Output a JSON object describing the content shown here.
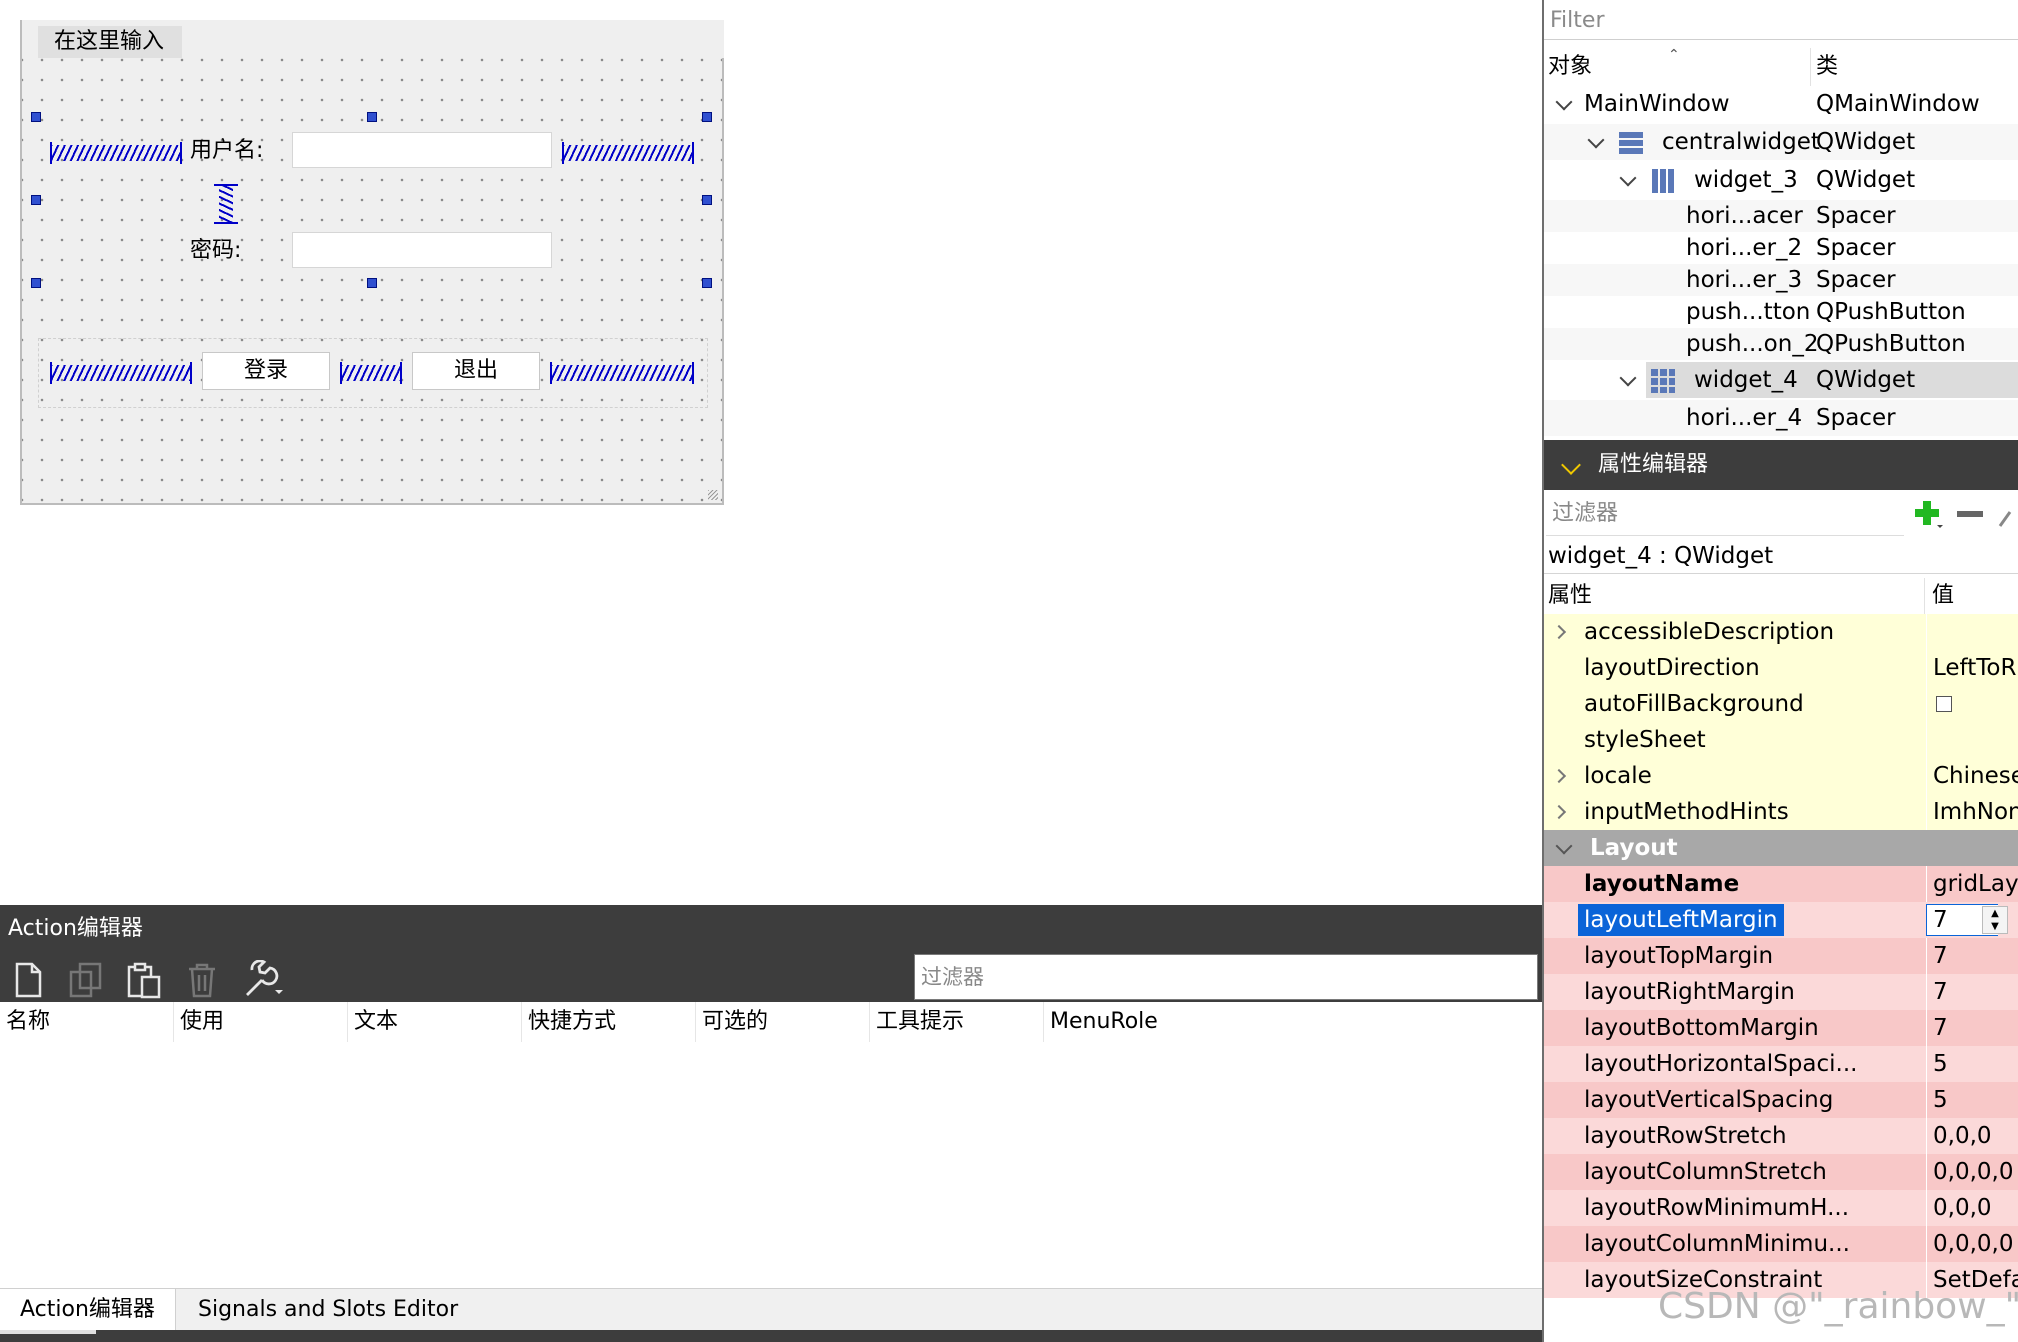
{
  "form": {
    "menu_title": "在这里输入",
    "username_label": "用户名:",
    "password_label": "密码:",
    "login_button": "登录",
    "exit_button": "退出"
  },
  "action_editor": {
    "title": "Action编辑器",
    "filter_placeholder": "过滤器",
    "columns": [
      "名称",
      "使用",
      "文本",
      "快捷方式",
      "可选的",
      "工具提示",
      "MenuRole"
    ],
    "toolbar_icons": [
      "new-action-icon",
      "copy-action-icon",
      "paste-action-icon",
      "delete-action-icon",
      "configure-wrench-icon"
    ]
  },
  "bottom_tabs": [
    "Action编辑器",
    "Signals and Slots Editor"
  ],
  "object_inspector": {
    "filter_placeholder": "Filter",
    "headers": {
      "object": "对象",
      "class": "类"
    },
    "rows": [
      {
        "name": "MainWindow",
        "class": "QMainWindow",
        "icon": ""
      },
      {
        "name": "centralwidget",
        "class": "QWidget",
        "icon": "vertical-layout-icon"
      },
      {
        "name": "widget_3",
        "class": "QWidget",
        "icon": "horizontal-layout-icon"
      },
      {
        "name": "hori...acer",
        "class": "Spacer",
        "icon": ""
      },
      {
        "name": "hori...er_2",
        "class": "Spacer",
        "icon": ""
      },
      {
        "name": "hori...er_3",
        "class": "Spacer",
        "icon": ""
      },
      {
        "name": "push...tton",
        "class": "QPushButton",
        "icon": ""
      },
      {
        "name": "push...on_2",
        "class": "QPushButton",
        "icon": ""
      },
      {
        "name": "widget_4",
        "class": "QWidget",
        "icon": "grid-layout-icon"
      },
      {
        "name": "hori...er_4",
        "class": "Spacer",
        "icon": ""
      }
    ]
  },
  "property_editor": {
    "title": "属性编辑器",
    "filter_placeholder": "过滤器",
    "object_label": "widget_4 : QWidget",
    "headers": {
      "property": "属性",
      "value": "值"
    },
    "widget_props": [
      {
        "name": "accessibleDescription",
        "value": ""
      },
      {
        "name": "layoutDirection",
        "value": "LeftToRight"
      },
      {
        "name": "autoFillBackground",
        "value": ""
      },
      {
        "name": "styleSheet",
        "value": ""
      },
      {
        "name": "locale",
        "value": "Chinese, China"
      },
      {
        "name": "inputMethodHints",
        "value": "ImhNone"
      }
    ],
    "layout_section": "Layout",
    "layout_props": [
      {
        "name": "layoutName",
        "value": "gridLayout"
      },
      {
        "name": "layoutLeftMargin",
        "value": "7"
      },
      {
        "name": "layoutTopMargin",
        "value": "7"
      },
      {
        "name": "layoutRightMargin",
        "value": "7"
      },
      {
        "name": "layoutBottomMargin",
        "value": "7"
      },
      {
        "name": "layoutHorizontalSpaci...",
        "value": "5"
      },
      {
        "name": "layoutVerticalSpacing",
        "value": "5"
      },
      {
        "name": "layoutRowStretch",
        "value": "0,0,0"
      },
      {
        "name": "layoutColumnStretch",
        "value": "0,0,0,0"
      },
      {
        "name": "layoutRowMinimumH...",
        "value": "0,0,0"
      },
      {
        "name": "layoutColumnMinimu...",
        "value": "0,0,0,0"
      },
      {
        "name": "layoutSizeConstraint",
        "value": "SetDefaultCo..."
      }
    ]
  },
  "watermark": "CSDN @\"_rainbow_\"",
  "colors": {
    "spacer": "#0000c8",
    "dark_panel": "#3d3d3d",
    "prop_yellow": "#ffffd8",
    "prop_pink": "#f8c8c8",
    "selection": "#0a64d8"
  }
}
